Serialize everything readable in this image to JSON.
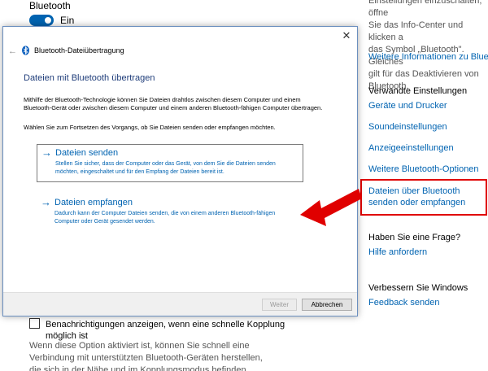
{
  "settings": {
    "bluetooth_heading": "Bluetooth",
    "toggle_label": "Ein",
    "info_text_lines": [
      "Einstellungen einzuschalten, öffne",
      "Sie das Info-Center und klicken a",
      "das Symbol „Bluetooth\". Gleiches",
      "gilt für das Deaktivieren von",
      "Bluetooth."
    ],
    "more_info_link": "Weitere Informationen zu Bluetoo",
    "related_heading": "Verwandte Einstellungen",
    "related_links": [
      "Geräte und Drucker",
      "Soundeinstellungen",
      "Anzeigeeinstellungen",
      "Weitere Bluetooth-Optionen"
    ],
    "highlighted_link": "Dateien über Bluetooth senden oder empfangen",
    "question_heading": "Haben Sie eine Frage?",
    "help_link": "Hilfe anfordern",
    "improve_heading": "Verbessern Sie Windows",
    "feedback_link": "Feedback senden",
    "notification_checkbox_label": "Benachrichtigungen anzeigen, wenn eine schnelle Kopplung möglich ist",
    "notification_desc": "Wenn diese Option aktiviert ist, können Sie schnell eine Verbindung mit unterstützten Bluetooth-Geräten herstellen, die sich in der Nähe und im Kopplungsmodus befinden."
  },
  "dialog": {
    "back_glyph": "←",
    "close_glyph": "✕",
    "title": "Bluetooth-Dateiübertragung",
    "heading": "Dateien mit Bluetooth übertragen",
    "paragraph": "Mithilfe der Bluetooth-Technologie können Sie Dateien drahtlos zwischen diesem Computer und einem Bluetooth-Gerät oder zwischen diesem Computer und einem anderen Bluetooth-fähigen Computer übertragen.",
    "instruction": "Wählen Sie zum Fortsetzen des Vorgangs, ob Sie Dateien senden oder empfangen möchten.",
    "send_option": {
      "arrow": "→",
      "title": "Dateien senden",
      "desc": "Stellen Sie sicher, dass der Computer oder das Gerät, von dem Sie die Dateien senden möchten, eingeschaltet und für den Empfang der Dateien bereit ist."
    },
    "receive_option": {
      "arrow": "→",
      "title": "Dateien empfangen",
      "desc": "Dadurch kann der Computer Dateien senden, die von einem anderen Bluetooth-fähigen Computer oder Gerät gesendet werden."
    },
    "next_button": "Weiter",
    "cancel_button": "Abbrechen"
  },
  "colors": {
    "accent": "#0063b1",
    "highlight_red": "#e00000",
    "heading_blue": "#1f3d7a"
  },
  "icons": {
    "bluetooth": "bluetooth-icon",
    "annotation": "red-arrow-icon"
  }
}
